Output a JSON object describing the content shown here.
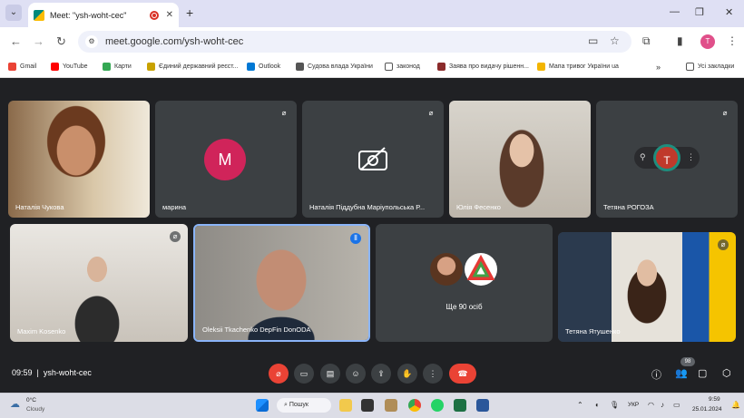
{
  "browser": {
    "tab_title": "Meet: \"ysh-woht-cec\"",
    "url": "meet.google.com/ysh-woht-cec",
    "profile_initial": "T",
    "bookmarks": [
      "Gmail",
      "YouTube",
      "Карти",
      "Єдиний державний реєст...",
      "Outlook",
      "Судова влада України",
      "законод",
      "Заява про видачу рішенн...",
      "Мапа тривог України ua",
      "Усі закладки"
    ]
  },
  "meet": {
    "participants": [
      {
        "name": "Наталія Чукова",
        "muted": false,
        "type": "video"
      },
      {
        "name": "марина",
        "muted": true,
        "type": "avatar",
        "initial": "M",
        "color": "#d0245a"
      },
      {
        "name": "Наталія Піддубна Маріупольська Р...",
        "muted": true,
        "type": "camera-off"
      },
      {
        "name": "Юлія Фесенко",
        "muted": false,
        "type": "video"
      },
      {
        "name": "Тетяна РОГОЗА",
        "muted": true,
        "type": "avatar",
        "initial": "T",
        "color": "#c0392b"
      },
      {
        "name": "Maxim Kosenko",
        "muted": true,
        "type": "video"
      },
      {
        "name": "Oleksii Tkachenko DepFin DonODA",
        "muted": false,
        "type": "video",
        "speaking": true
      },
      {
        "name": "Ще 90 осіб",
        "muted": false,
        "type": "others"
      },
      {
        "name": "Тетяна Ятушенко",
        "muted": true,
        "type": "video"
      }
    ],
    "time": "09:59",
    "meeting_code": "ysh-woht-cec",
    "participant_count": "98"
  },
  "taskbar": {
    "weather_temp": "0°C",
    "weather_desc": "Cloudy",
    "search_label": "Пошук",
    "lang": "УКР",
    "time": "9:59",
    "date": "25.01.2024"
  },
  "colors": {
    "accent_red": "#ea4335",
    "speaking_border": "#8ab4f8"
  }
}
